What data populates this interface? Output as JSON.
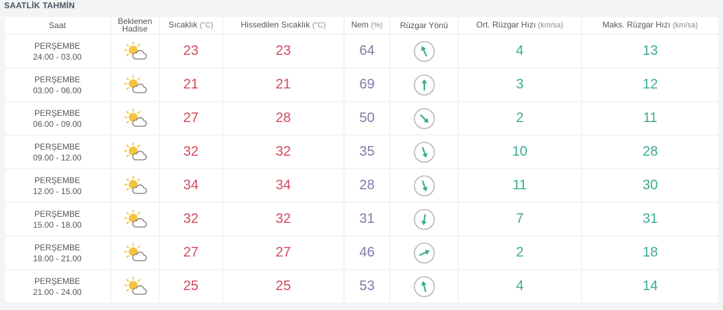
{
  "section_title": "SAATLİK TAHMİN",
  "headers": {
    "time": "Saat",
    "condition_line1": "Beklenen",
    "condition_line2": "Hadise",
    "temperature": "Sıcaklık",
    "temperature_unit": "(°C)",
    "feels_like": "Hissedilen Sıcaklık",
    "feels_like_unit": "(°C)",
    "humidity": "Nem",
    "humidity_unit": "(%)",
    "wind_direction": "Rüzgar Yönü",
    "avg_wind": "Ort. Rüzgar Hızı",
    "avg_wind_unit": "(km/sa)",
    "max_wind": "Maks. Rüzgar Hızı",
    "max_wind_unit": "(km/sa)"
  },
  "colors": {
    "temperature": "#d34a5e",
    "humidity": "#7a7ea8",
    "wind": "#3bab93",
    "sun": "#f5c542",
    "cloud_stroke": "#777777"
  },
  "rows": [
    {
      "day": "PERŞEMBE",
      "period": "24.00 - 03.00",
      "icon": "partly-cloudy-icon",
      "temp": "23",
      "feels": "23",
      "humidity": "64",
      "wind_dir_deg": 335,
      "avg_wind": "4",
      "max_wind": "13"
    },
    {
      "day": "PERŞEMBE",
      "period": "03.00 - 06.00",
      "icon": "partly-cloudy-icon",
      "temp": "21",
      "feels": "21",
      "humidity": "69",
      "wind_dir_deg": 0,
      "avg_wind": "3",
      "max_wind": "12"
    },
    {
      "day": "PERŞEMBE",
      "period": "06.00 - 09.00",
      "icon": "partly-cloudy-icon",
      "temp": "27",
      "feels": "28",
      "humidity": "50",
      "wind_dir_deg": 135,
      "avg_wind": "2",
      "max_wind": "11"
    },
    {
      "day": "PERŞEMBE",
      "period": "09.00 - 12.00",
      "icon": "partly-cloudy-icon",
      "temp": "32",
      "feels": "32",
      "humidity": "35",
      "wind_dir_deg": 160,
      "avg_wind": "10",
      "max_wind": "28"
    },
    {
      "day": "PERŞEMBE",
      "period": "12.00 - 15.00",
      "icon": "partly-cloudy-icon",
      "temp": "34",
      "feels": "34",
      "humidity": "28",
      "wind_dir_deg": 160,
      "avg_wind": "11",
      "max_wind": "30"
    },
    {
      "day": "PERŞEMBE",
      "period": "15.00 - 18.00",
      "icon": "partly-cloudy-icon",
      "temp": "32",
      "feels": "32",
      "humidity": "31",
      "wind_dir_deg": 190,
      "avg_wind": "7",
      "max_wind": "31"
    },
    {
      "day": "PERŞEMBE",
      "period": "18.00 - 21.00",
      "icon": "partly-cloudy-icon",
      "temp": "27",
      "feels": "27",
      "humidity": "46",
      "wind_dir_deg": 65,
      "avg_wind": "2",
      "max_wind": "18"
    },
    {
      "day": "PERŞEMBE",
      "period": "21.00 - 24.00",
      "icon": "partly-cloudy-icon",
      "temp": "25",
      "feels": "25",
      "humidity": "53",
      "wind_dir_deg": 345,
      "avg_wind": "4",
      "max_wind": "14"
    }
  ]
}
